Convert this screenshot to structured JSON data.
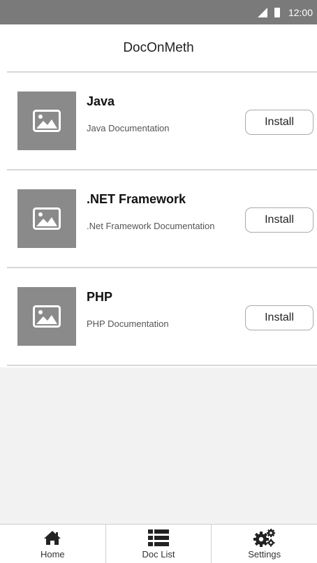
{
  "status_bar": {
    "time": "12:00",
    "icons": [
      "signal-icon",
      "battery-icon"
    ]
  },
  "header": {
    "title": "DocOnMeth"
  },
  "docs": [
    {
      "title": "Java",
      "description": "Java Documentation",
      "button": "Install",
      "icon": "image-placeholder-icon"
    },
    {
      "title": ".NET Framework",
      "description": ".Net Framework Documentation",
      "button": "Install",
      "icon": "image-placeholder-icon"
    },
    {
      "title": "PHP",
      "description": "PHP Documentation",
      "button": "Install",
      "icon": "image-placeholder-icon"
    }
  ],
  "bottom_nav": {
    "items": [
      {
        "label": "Home",
        "icon": "home-icon"
      },
      {
        "label": "Doc List",
        "icon": "list-icon"
      },
      {
        "label": "Settings",
        "icon": "cogs-icon"
      }
    ]
  }
}
